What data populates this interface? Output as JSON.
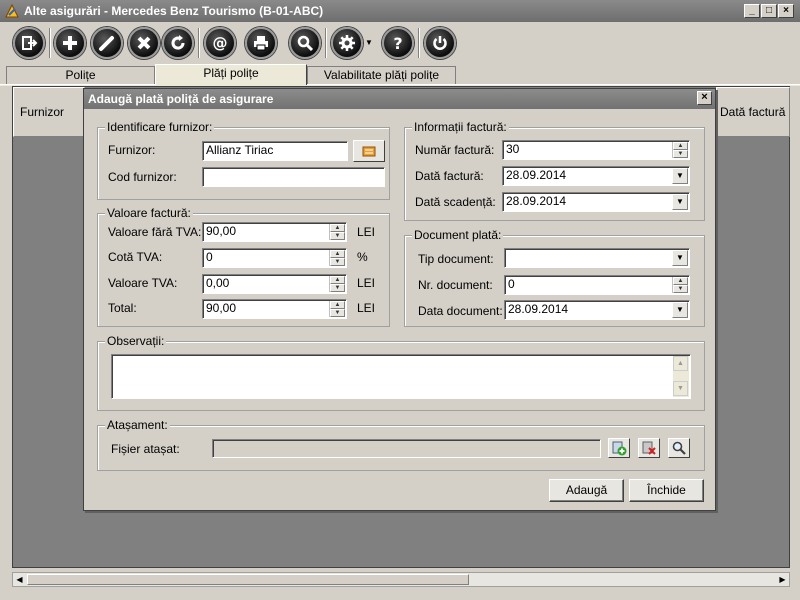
{
  "window": {
    "title": "Alte asigurări - Mercedes Benz Tourismo (B-01-ABC)",
    "minimize": "_",
    "maximize": "□",
    "close": "×"
  },
  "toolbar": {
    "icons": [
      "exit-icon",
      "add-icon",
      "edit-icon",
      "delete-icon",
      "refresh-icon",
      "email-icon",
      "print-icon",
      "search-icon",
      "settings-icon",
      "help-icon",
      "power-icon"
    ]
  },
  "tabs": [
    "Polițe",
    "Plăți polițe",
    "Valabilitate plăți polițe"
  ],
  "background": {
    "col_left": "Furnizor",
    "col_right": "Dată factură"
  },
  "dialog": {
    "title": "Adaugă plată poliță de asigurare",
    "close": "×",
    "supplier_group": {
      "title": "Identificare furnizor:",
      "supplier_label": "Furnizor:",
      "supplier_value": "Allianz Tiriac",
      "code_label": "Cod furnizor:",
      "code_value": ""
    },
    "invoice_value_group": {
      "title": "Valoare factură:",
      "rows": [
        {
          "label": "Valoare fără TVA:",
          "value": "90,00",
          "unit": "LEI"
        },
        {
          "label": "Cotă TVA:",
          "value": "0",
          "unit": "%"
        },
        {
          "label": "Valoare TVA:",
          "value": "0,00",
          "unit": "LEI"
        },
        {
          "label": "Total:",
          "value": "90,00",
          "unit": "LEI"
        }
      ]
    },
    "invoice_info_group": {
      "title": "Informații factură:",
      "number_label": "Număr factură:",
      "number_value": "30",
      "date_label": "Dată factură:",
      "date_value": "28.09.2014",
      "due_label": "Dată scadență:",
      "due_value": "28.09.2014"
    },
    "payment_doc_group": {
      "title": "Document plată:",
      "type_label": "Tip document:",
      "type_value": "",
      "nr_label": "Nr. document:",
      "nr_value": "0",
      "date_label": "Data document:",
      "date_value": "28.09.2014"
    },
    "notes_group": {
      "title": "Observații:",
      "value": ""
    },
    "attachment_group": {
      "title": "Atașament:",
      "file_label": "Fișier atașat:",
      "file_value": ""
    },
    "buttons": {
      "add": "Adaugă",
      "close": "Închide"
    }
  }
}
